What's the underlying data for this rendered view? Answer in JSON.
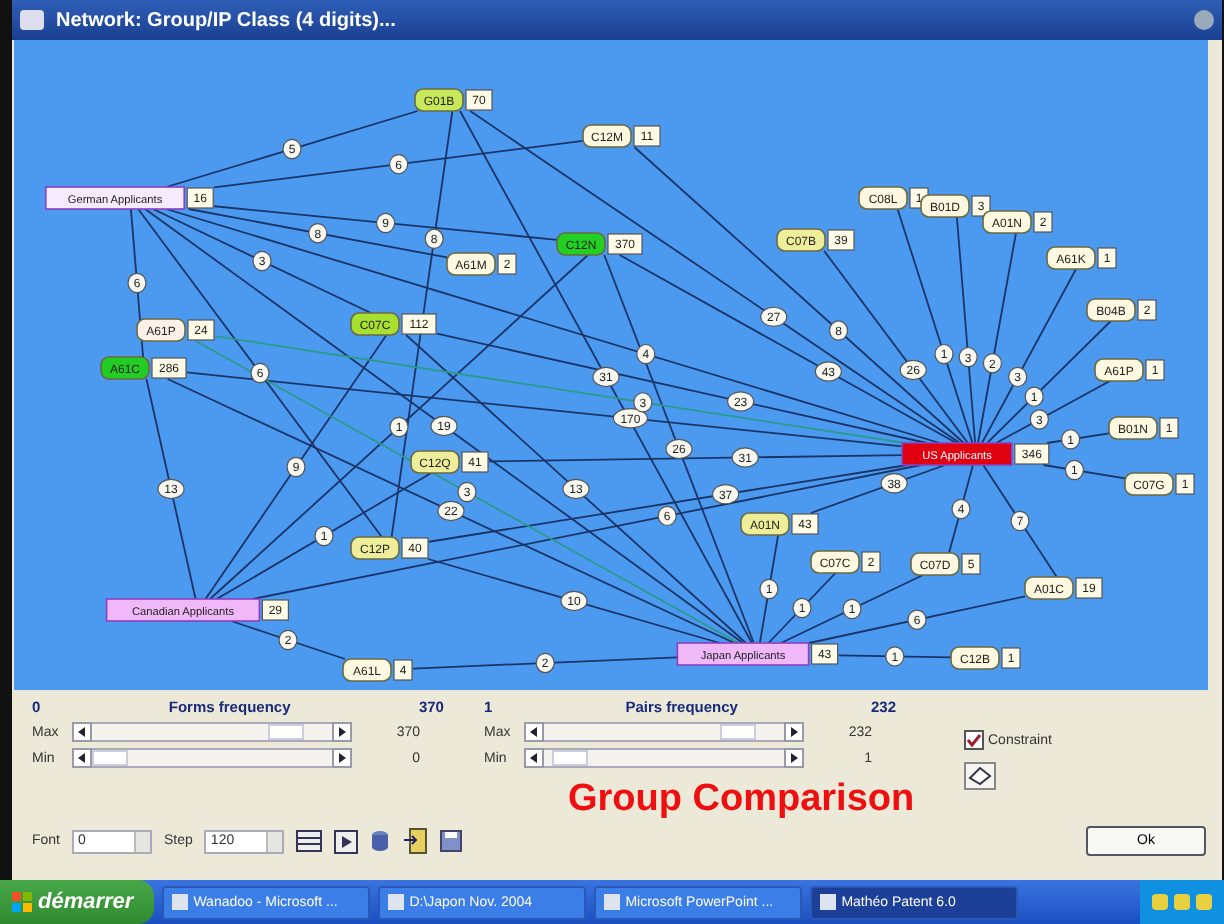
{
  "window": {
    "title": "Network: Group/IP Class (4 digits)..."
  },
  "network": {
    "nodes": [
      {
        "label": "G01B",
        "count": "70",
        "kind": "class",
        "color": "#c8e85a"
      },
      {
        "label": "C12M",
        "count": "11",
        "kind": "class",
        "color": "#fff8e0"
      },
      {
        "label": "German Applicants",
        "count": "16",
        "kind": "applicant",
        "color": "#f6eaff"
      },
      {
        "label": "C12N",
        "count": "370",
        "kind": "class",
        "color": "#22d022"
      },
      {
        "label": "A61M",
        "count": "2",
        "kind": "class",
        "color": "#fff8e0"
      },
      {
        "label": "C07B",
        "count": "39",
        "kind": "class",
        "color": "#eeee9a"
      },
      {
        "label": "C08L",
        "count": "1",
        "kind": "class",
        "color": "#fff8e0"
      },
      {
        "label": "B01D",
        "count": "3",
        "kind": "class",
        "color": "#fff8e0"
      },
      {
        "label": "A01N",
        "count": "2",
        "kind": "class",
        "color": "#fff8e0"
      },
      {
        "label": "A61K",
        "count": "1",
        "kind": "class",
        "color": "#fff8e0"
      },
      {
        "label": "B04B",
        "count": "2",
        "kind": "class",
        "color": "#fff8e0"
      },
      {
        "label": "A61P",
        "count": "1",
        "kind": "class",
        "color": "#fff8e0"
      },
      {
        "label": "B01N",
        "count": "1",
        "kind": "class",
        "color": "#fff8e0"
      },
      {
        "label": "C07G",
        "count": "1",
        "kind": "class",
        "color": "#fff8e0"
      },
      {
        "label": "C07C",
        "count": "112",
        "kind": "class",
        "color": "#a8e030"
      },
      {
        "label": "A61P",
        "count": "24",
        "kind": "class",
        "color": "#fff0ea"
      },
      {
        "label": "A61C",
        "count": "286",
        "kind": "class",
        "color": "#22cc22"
      },
      {
        "label": "C12Q",
        "count": "41",
        "kind": "class",
        "color": "#eeee9a"
      },
      {
        "label": "US Applicants",
        "count": "346",
        "kind": "applicant",
        "color": "#e00010"
      },
      {
        "label": "C12P",
        "count": "40",
        "kind": "class",
        "color": "#eeee9a"
      },
      {
        "label": "A01N",
        "count": "43",
        "kind": "class",
        "color": "#eeee9a"
      },
      {
        "label": "C07C",
        "count": "2",
        "kind": "class",
        "color": "#fff8e0"
      },
      {
        "label": "C07D",
        "count": "5",
        "kind": "class",
        "color": "#fff8e0"
      },
      {
        "label": "A01C",
        "count": "19",
        "kind": "class",
        "color": "#fff8e0"
      },
      {
        "label": "Canadian Applicants",
        "count": "29",
        "kind": "applicant",
        "color": "#f0b8f8"
      },
      {
        "label": "Japan Applicants",
        "count": "43",
        "kind": "applicant",
        "color": "#f0b8f8"
      },
      {
        "label": "A61L",
        "count": "4",
        "kind": "class",
        "color": "#fff8e0"
      },
      {
        "label": "C12B",
        "count": "1",
        "kind": "class",
        "color": "#fff8e0"
      }
    ],
    "edges": [
      {
        "label": "5",
        "kind": "primary"
      },
      {
        "label": "6",
        "kind": "primary"
      },
      {
        "label": "9",
        "kind": "primary"
      },
      {
        "label": "8",
        "kind": "primary"
      },
      {
        "label": "4",
        "kind": "primary"
      },
      {
        "label": "6",
        "kind": "primary"
      },
      {
        "label": "3",
        "kind": "primary"
      },
      {
        "label": "6",
        "kind": "primary"
      },
      {
        "label": "19",
        "kind": "primary"
      },
      {
        "label": "13",
        "kind": "primary"
      },
      {
        "label": "8",
        "kind": "primary"
      },
      {
        "label": "27",
        "kind": "primary"
      },
      {
        "label": "31",
        "kind": "primary"
      },
      {
        "label": "8",
        "kind": "primary"
      },
      {
        "label": "43",
        "kind": "primary"
      },
      {
        "label": "1",
        "kind": "primary"
      },
      {
        "label": "26",
        "kind": "primary"
      },
      {
        "label": "26",
        "kind": "primary"
      },
      {
        "label": "1",
        "kind": "primary"
      },
      {
        "label": "3",
        "kind": "primary"
      },
      {
        "label": "2",
        "kind": "primary"
      },
      {
        "label": "3",
        "kind": "primary"
      },
      {
        "label": "1",
        "kind": "primary"
      },
      {
        "label": "3",
        "kind": "primary"
      },
      {
        "label": "1",
        "kind": "primary"
      },
      {
        "label": "1",
        "kind": "primary"
      },
      {
        "label": "23",
        "kind": "primary"
      },
      {
        "label": "9",
        "kind": "primary"
      },
      {
        "label": "13",
        "kind": "primary"
      },
      {
        "label": "170",
        "kind": "primary"
      },
      {
        "label": "22",
        "kind": "primary"
      },
      {
        "label": "1",
        "kind": "primary"
      },
      {
        "label": "6",
        "kind": "primary"
      },
      {
        "label": "2",
        "kind": "primary"
      },
      {
        "label": "10",
        "kind": "primary"
      },
      {
        "label": "31",
        "kind": "primary"
      },
      {
        "label": "37",
        "kind": "primary"
      },
      {
        "label": "1",
        "kind": "primary"
      },
      {
        "label": "2",
        "kind": "primary"
      },
      {
        "label": "1",
        "kind": "primary"
      },
      {
        "label": "1",
        "kind": "primary"
      },
      {
        "label": "6",
        "kind": "primary"
      },
      {
        "label": "1",
        "kind": "primary"
      },
      {
        "label": "4",
        "kind": "primary"
      },
      {
        "label": "7",
        "kind": "primary"
      },
      {
        "label": "3",
        "kind": "secondary"
      },
      {
        "label": "3",
        "kind": "secondary"
      },
      {
        "label": "38",
        "kind": "primary"
      }
    ]
  },
  "filters": [
    {
      "low": "0",
      "title": "Forms frequency",
      "high": "370",
      "sliders": [
        {
          "label": "Max",
          "level": 0.86,
          "reading": "370"
        },
        {
          "label": "Min",
          "level": 0.0,
          "reading": "0"
        }
      ]
    },
    {
      "low": "1",
      "title": "Pairs frequency",
      "high": "232",
      "sliders": [
        {
          "label": "Max",
          "level": 0.86,
          "reading": "232"
        },
        {
          "label": "Min",
          "level": 0.04,
          "reading": "1"
        }
      ]
    }
  ],
  "constraint": {
    "label": "Constraint",
    "checked": true
  },
  "caption": "Group Comparison",
  "toolbar": {
    "font_label": "Font",
    "font_value": "0",
    "step_label": "Step",
    "step_value": "120"
  },
  "ok_button": "Ok",
  "taskbar": {
    "start": "démarrer",
    "tasks": [
      {
        "label": "Wanadoo - Microsoft ...",
        "selected": false
      },
      {
        "label": "D:\\Japon Nov. 2004",
        "selected": false
      },
      {
        "label": "Microsoft PowerPoint ...",
        "selected": false
      },
      {
        "label": "Mathéo Patent 6.0",
        "selected": true
      }
    ]
  }
}
